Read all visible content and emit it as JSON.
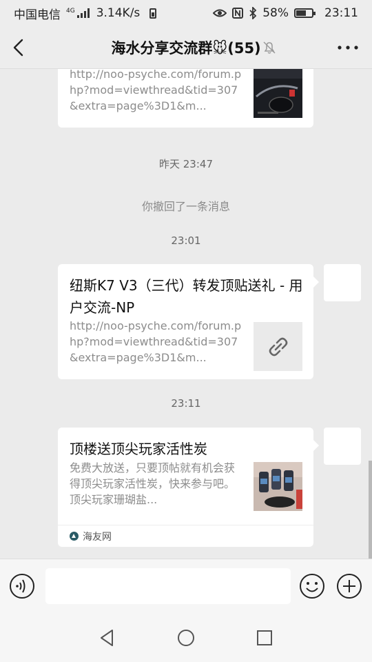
{
  "status": {
    "carrier": "中国电信",
    "network_tag": "4G",
    "speed": "3.14K/s",
    "battery": "58%",
    "time": "23:11"
  },
  "header": {
    "title": "海水分享交流群🐭(55)",
    "back_icon": "chevron-left-icon",
    "mute_icon": "bell-off-icon",
    "more_icon": "more-dots-icon"
  },
  "messages": {
    "card1": {
      "desc": "http://noo-psyche.com/forum.php?mod=viewthread&tid=307&extra=page%3D1&m..."
    },
    "time1": "昨天 23:47",
    "recall": "你撤回了一条消息",
    "time2": "23:01",
    "card2": {
      "title": "纽斯K7 V3（三代）转发顶贴送礼 - 用户交流-NP",
      "desc": "http://noo-psyche.com/forum.php?mod=viewthread&tid=307&extra=page%3D1&m...",
      "thumb_icon": "link-icon"
    },
    "time3": "23:11",
    "card3": {
      "title": "顶楼送顶尖玩家活性炭",
      "desc": "免费大放送，只要顶帖就有机会获得顶尖玩家活性炭，快来参与吧。顶尖玩家珊瑚盐...",
      "source": "海友网"
    }
  },
  "input": {
    "value": "",
    "voice_icon": "voice-icon",
    "emoji_icon": "emoji-icon",
    "plus_icon": "plus-icon"
  },
  "nav": {
    "back_icon": "nav-back-icon",
    "home_icon": "nav-home-icon",
    "recent_icon": "nav-recent-icon"
  },
  "colors": {
    "background": "#ebebeb",
    "bar": "#ededed",
    "card": "#ffffff",
    "muted_text": "#8c8c8c"
  }
}
